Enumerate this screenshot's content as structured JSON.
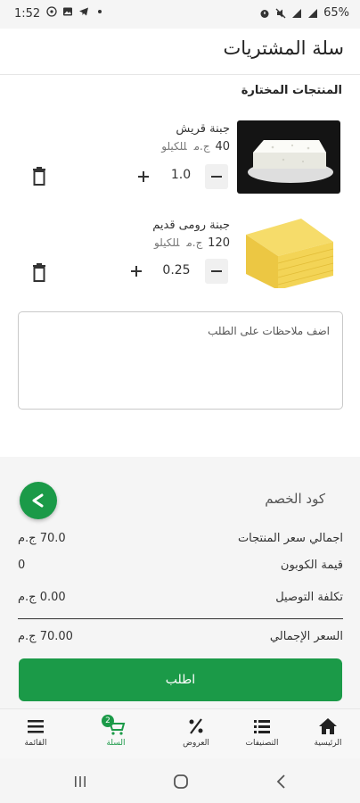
{
  "status": {
    "time": "1:52",
    "battery": "65%"
  },
  "header": {
    "title": "سلة المشتريات"
  },
  "section_title": "المنتجات المختارة",
  "products": [
    {
      "name": "جبنة قريش",
      "price": "40",
      "currency": "ج.م",
      "per": "للكيلو",
      "quantity": "1.0",
      "image": "white-cheese-image"
    },
    {
      "name": "جبنة رومى قديم",
      "price": "120",
      "currency": "ج.م",
      "per": "للكيلو",
      "quantity": "0.25",
      "image": "roumy-cheese-image"
    }
  ],
  "notes": {
    "placeholder": "اضف ملاحظات على الطلب"
  },
  "summary": {
    "coupon_label": "كود الخصم",
    "products_total_label": "اجمالي سعر المنتجات",
    "products_total_value": "70.0 ج.م",
    "coupon_value_label": "قيمة الكوبون",
    "coupon_value": "0",
    "delivery_label": "تكلفة التوصيل",
    "delivery_value": "0.00 ج.م",
    "grand_total_label": "السعر الإجمالي",
    "grand_total_value": "70.00 ج.م",
    "order_button": "اطلب"
  },
  "bottom_nav": {
    "cart_badge": "2",
    "items": [
      {
        "label": "القائمة",
        "icon": "menu-icon"
      },
      {
        "label": "السلة",
        "icon": "cart-icon"
      },
      {
        "label": "العروض",
        "icon": "percent-icon"
      },
      {
        "label": "التصنيفات",
        "icon": "list-icon"
      },
      {
        "label": "الرئيسية",
        "icon": "home-icon"
      }
    ]
  },
  "colors": {
    "accent": "#1b9a48",
    "summary_bg": "#f5f5f5"
  }
}
